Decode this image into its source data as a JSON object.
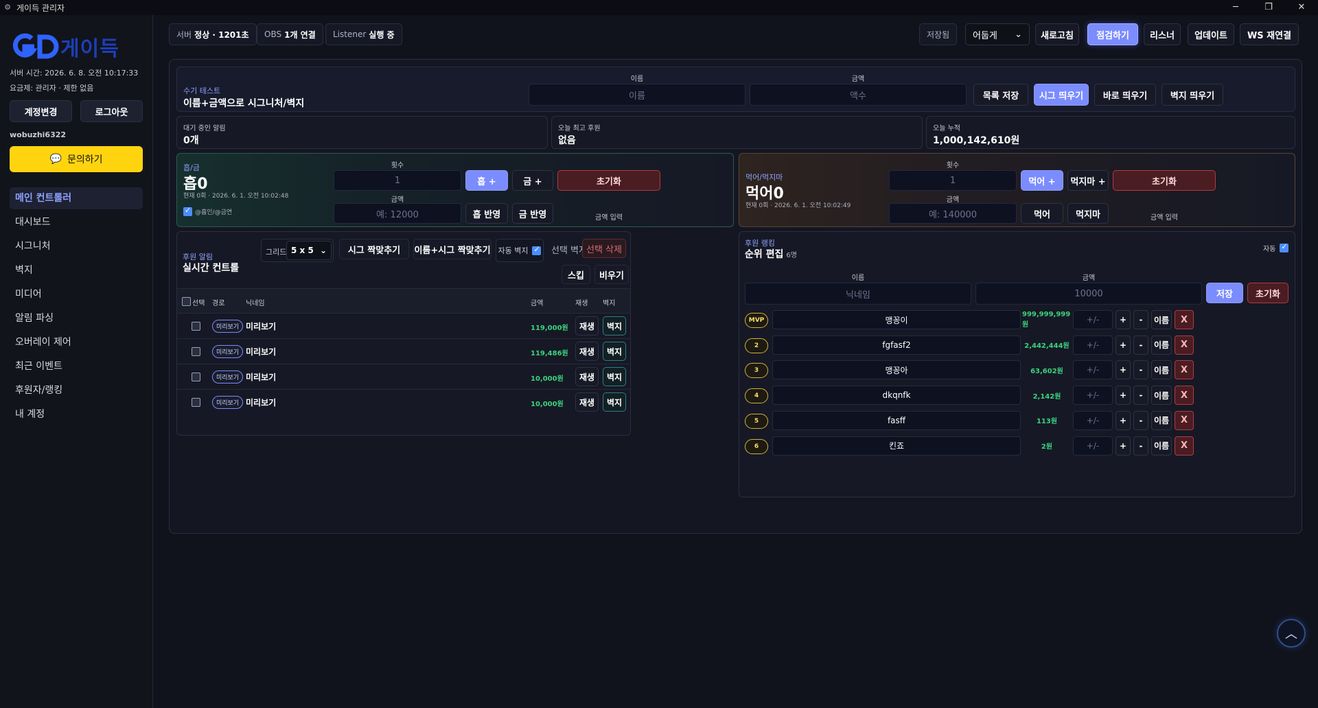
{
  "window": {
    "title": "게이득 관리자"
  },
  "sidebar": {
    "logo_text": "게이득",
    "server_time": "서버 시간: 2026. 6. 8. 오전 10:17:33",
    "plan": "요금제: 관리자 · 제한 없음",
    "switch_account": "계정변경",
    "logout": "로그아웃",
    "username": "wobuzhi6322",
    "inquiry": "문의하기",
    "nav": [
      "메인 컨트롤러",
      "대시보드",
      "시그니처",
      "벽지",
      "미디어",
      "알림 파싱",
      "오버레이 제어",
      "최근 이벤트",
      "후원자/랭킹",
      "내 계정"
    ]
  },
  "topbar": {
    "server_label": "서버",
    "server_value": "정상 · 1201초",
    "obs_label": "OBS",
    "obs_value": "1개 연결",
    "listener_label": "Listener",
    "listener_value": "실행 중",
    "saved": "저장됨",
    "theme": "어둡게",
    "refresh": "새로고침",
    "inspect": "점검하기",
    "listener": "리스너",
    "update": "업데이트",
    "ws_reconnect": "WS 재연결"
  },
  "manual_test": {
    "tag": "수기 테스트",
    "title": "이름+금액으로 시그니처/벽지",
    "name_label": "이름",
    "name_placeholder": "이름",
    "amount_label": "금액",
    "amount_placeholder": "액수",
    "save_list": "목록 저장",
    "show_sig": "시그 띄우기",
    "show_now": "바로 띄우기",
    "show_wall": "벽지 띄우기"
  },
  "stats": [
    {
      "label": "대기 중인 알림",
      "value": "0개"
    },
    {
      "label": "오늘 최고 후원",
      "value": "없음"
    },
    {
      "label": "오늘 누적",
      "value": "1,000,142,610원"
    }
  ],
  "heum": {
    "tag": "흡/금",
    "big": "흡0",
    "current": "현재 0회 · 2026. 6. 1. 오전 10:02:48",
    "check_label": "@흡인/@금연",
    "count_label": "횟수",
    "count_value": "1",
    "plus_a": "흡 +",
    "plus_b": "금 +",
    "reset": "초기화",
    "amount_label": "금액",
    "amount_placeholder": "예: 12000",
    "apply_a": "흡 반영",
    "apply_b": "금 반영",
    "amount_input": "금액 입력"
  },
  "meok": {
    "tag": "먹어/먹지마",
    "big": "먹어0",
    "current": "현재 0회 · 2026. 6. 1. 오전 10:02:49",
    "count_label": "횟수",
    "count_value": "1",
    "plus_a": "먹어 +",
    "plus_b": "먹지마 +",
    "reset": "초기화",
    "amount_label": "금액",
    "amount_placeholder": "예: 140000",
    "apply_a": "먹어",
    "apply_b": "먹지마",
    "amount_input": "금액 입력"
  },
  "alerts": {
    "tag": "후원 알림",
    "title": "실시간 컨트롤",
    "grid_label": "그리드",
    "grid_value": "5 x 5",
    "sig_fit": "시그 짝맞추기",
    "name_sig_fit": "이름+시그 짝맞추기",
    "auto_wall": "자동 벽지",
    "select_wall": "선택 벽지",
    "select_delete": "선택 삭제",
    "skip": "스킵",
    "clear": "비우기",
    "columns": [
      "선택",
      "경로",
      "닉네임",
      "금액",
      "재생",
      "벽지"
    ],
    "rows": [
      {
        "badge": "미리보기",
        "nick": "미리보기",
        "amount": "119,000원",
        "play": "재생",
        "wall": "벽지"
      },
      {
        "badge": "미리보기",
        "nick": "미리보기",
        "amount": "119,486원",
        "play": "재생",
        "wall": "벽지"
      },
      {
        "badge": "미리보기",
        "nick": "미리보기",
        "amount": "10,000원",
        "play": "재생",
        "wall": "벽지"
      },
      {
        "badge": "미리보기",
        "nick": "미리보기",
        "amount": "10,000원",
        "play": "재생",
        "wall": "벽지"
      }
    ]
  },
  "ranking": {
    "tag": "후원 랭킹",
    "title": "순위 편집",
    "count": "6명",
    "auto": "자동",
    "name_label": "이름",
    "name_placeholder": "닉네임",
    "amount_label": "금액",
    "amount_placeholder": "10000",
    "save": "저장",
    "reset": "초기화",
    "rows": [
      {
        "rank": "MVP",
        "name": "맹꽁이",
        "amount": "999,999,999원"
      },
      {
        "rank": "2",
        "name": "fgfasf2",
        "amount": "2,442,444원"
      },
      {
        "rank": "3",
        "name": "맹꽁아",
        "amount": "63,602원"
      },
      {
        "rank": "4",
        "name": "dkqnfk",
        "amount": "2,142원"
      },
      {
        "rank": "5",
        "name": "fasff",
        "amount": "113원"
      },
      {
        "rank": "6",
        "name": "킨죠",
        "amount": "2원"
      }
    ],
    "pm": "+/-",
    "plus": "+",
    "minus": "-",
    "name_btn": "이름",
    "x": "X"
  },
  "colors": {
    "accent": "#7b8cff",
    "bg": "#11131c",
    "green": "#3cd27f",
    "yellow": "#ffd40f",
    "red": "#b13a42"
  }
}
